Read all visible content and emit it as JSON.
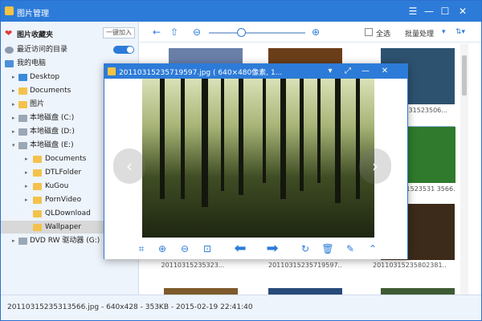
{
  "app": {
    "title": "图片管理",
    "controls": {
      "menu": "☰",
      "minimize": "—",
      "maximize": "☐",
      "close": "✕"
    }
  },
  "sidebar": {
    "favorites_label": "图片收藏夹",
    "add_button": "一键加入",
    "recent_label": "最近访问的目录",
    "tree": [
      {
        "label": "我的电脑",
        "level": 0,
        "arrow": "",
        "icon": "computer-icon"
      },
      {
        "label": "Desktop",
        "level": 1,
        "arrow": "▸",
        "icon": "desktop-icon"
      },
      {
        "label": "Documents",
        "level": 1,
        "arrow": "▸",
        "icon": "folder-icon"
      },
      {
        "label": "图片",
        "level": 1,
        "arrow": "▸",
        "icon": "folder-icon"
      },
      {
        "label": "本地磁盘 (C:)",
        "level": 1,
        "arrow": "▸",
        "icon": "drive-icon"
      },
      {
        "label": "本地磁盘 (D:)",
        "level": 1,
        "arrow": "▸",
        "icon": "drive-icon"
      },
      {
        "label": "本地磁盘 (E:)",
        "level": 1,
        "arrow": "▾",
        "icon": "drive-icon"
      },
      {
        "label": "Documents",
        "level": 2,
        "arrow": "▸",
        "icon": "folder-icon"
      },
      {
        "label": "DTLFolder",
        "level": 2,
        "arrow": "▸",
        "icon": "folder-icon"
      },
      {
        "label": "KuGou",
        "level": 2,
        "arrow": "▸",
        "icon": "folder-icon"
      },
      {
        "label": "PornVideo",
        "level": 2,
        "arrow": "▸",
        "icon": "folder-icon"
      },
      {
        "label": "QLDownload",
        "level": 2,
        "arrow": "",
        "icon": "folder-icon"
      },
      {
        "label": "Wallpaper",
        "level": 2,
        "arrow": "",
        "icon": "folder-icon",
        "selected": true
      },
      {
        "label": "DVD RW 驱动器 (G:)",
        "level": 1,
        "arrow": "▸",
        "icon": "dvd-icon"
      }
    ]
  },
  "toolbar": {
    "back": "←",
    "folder": "⇧",
    "zoom_out": "⊖",
    "zoom_in": "⊕",
    "select_all": "全选",
    "batch": "批量处理",
    "batch_arrow": "▾",
    "sort": "⇅▾"
  },
  "thumbnails": [
    {
      "caption": "",
      "color": "#6a7fa8"
    },
    {
      "caption": "",
      "color": "#6b3e1a"
    },
    {
      "caption": "2011031523506...",
      "color": "#2d5270"
    },
    {
      "caption": "2011031523531 3566...",
      "color": "#2f7a2c"
    },
    {
      "caption": "2011031523531 3566...",
      "color": "#3c2a1a"
    },
    {
      "caption": "20110315235323...",
      "color": "#3a6aa0"
    },
    {
      "caption": "20110315235719597...",
      "color": "#58492b"
    },
    {
      "caption": "20110315235802381...",
      "color": "#1c2a40"
    },
    {
      "caption": "",
      "color": "#7e5a2c"
    },
    {
      "caption": "",
      "color": "#284a7a"
    },
    {
      "caption": "",
      "color": "#3f5b34"
    },
    {
      "caption": "",
      "color": "#2f3d55"
    }
  ],
  "status": {
    "text": "20110315235313566.jpg - 640x428 - 353KB - 2015-02-19 22:41:40"
  },
  "viewer": {
    "title": "20110315235719597.jpg ( 640×480像素, 1...",
    "controls": {
      "dropdown": "▾",
      "fullscreen": "⤢",
      "minimize": "—",
      "close": "✕"
    },
    "tools": {
      "crop": "⌗",
      "zoom_in": "⊕",
      "zoom_out": "⊖",
      "fit": "⊡",
      "prev": "⬅",
      "next": "➡",
      "rotate": "↻",
      "delete": "🗑",
      "edit": "✎",
      "more": "⌃"
    },
    "side_prev": "‹",
    "side_next": "›"
  }
}
